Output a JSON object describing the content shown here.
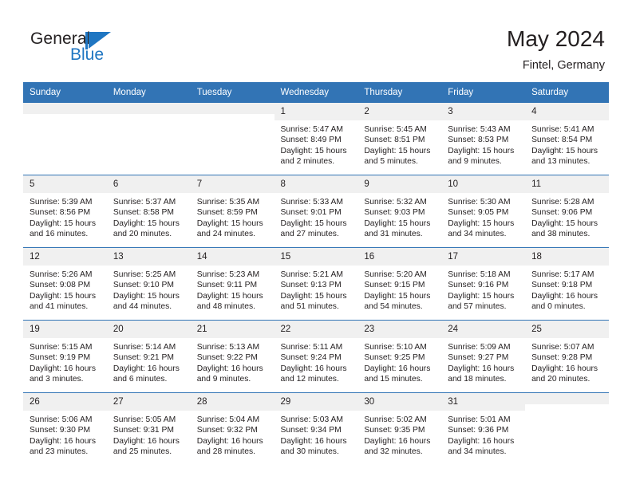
{
  "brand": {
    "name_part1": "General",
    "name_part2": "Blue",
    "flag_icon": "blue-flag-icon"
  },
  "header": {
    "title": "May 2024",
    "subtitle": "Fintel, Germany"
  },
  "colors": {
    "header_blue": "#3274b5",
    "brand_blue": "#1f76c2",
    "daynum_band": "#f0f0f0",
    "text": "#231f20"
  },
  "calendar": {
    "weekday_headers": [
      "Sunday",
      "Monday",
      "Tuesday",
      "Wednesday",
      "Thursday",
      "Friday",
      "Saturday"
    ],
    "weeks": [
      [
        {
          "day": "",
          "empty": true
        },
        {
          "day": "",
          "empty": true
        },
        {
          "day": "",
          "empty": true
        },
        {
          "day": "1",
          "sunrise": "Sunrise: 5:47 AM",
          "sunset": "Sunset: 8:49 PM",
          "daylight_line1": "Daylight: 15 hours",
          "daylight_line2": "and 2 minutes."
        },
        {
          "day": "2",
          "sunrise": "Sunrise: 5:45 AM",
          "sunset": "Sunset: 8:51 PM",
          "daylight_line1": "Daylight: 15 hours",
          "daylight_line2": "and 5 minutes."
        },
        {
          "day": "3",
          "sunrise": "Sunrise: 5:43 AM",
          "sunset": "Sunset: 8:53 PM",
          "daylight_line1": "Daylight: 15 hours",
          "daylight_line2": "and 9 minutes."
        },
        {
          "day": "4",
          "sunrise": "Sunrise: 5:41 AM",
          "sunset": "Sunset: 8:54 PM",
          "daylight_line1": "Daylight: 15 hours",
          "daylight_line2": "and 13 minutes."
        }
      ],
      [
        {
          "day": "5",
          "sunrise": "Sunrise: 5:39 AM",
          "sunset": "Sunset: 8:56 PM",
          "daylight_line1": "Daylight: 15 hours",
          "daylight_line2": "and 16 minutes."
        },
        {
          "day": "6",
          "sunrise": "Sunrise: 5:37 AM",
          "sunset": "Sunset: 8:58 PM",
          "daylight_line1": "Daylight: 15 hours",
          "daylight_line2": "and 20 minutes."
        },
        {
          "day": "7",
          "sunrise": "Sunrise: 5:35 AM",
          "sunset": "Sunset: 8:59 PM",
          "daylight_line1": "Daylight: 15 hours",
          "daylight_line2": "and 24 minutes."
        },
        {
          "day": "8",
          "sunrise": "Sunrise: 5:33 AM",
          "sunset": "Sunset: 9:01 PM",
          "daylight_line1": "Daylight: 15 hours",
          "daylight_line2": "and 27 minutes."
        },
        {
          "day": "9",
          "sunrise": "Sunrise: 5:32 AM",
          "sunset": "Sunset: 9:03 PM",
          "daylight_line1": "Daylight: 15 hours",
          "daylight_line2": "and 31 minutes."
        },
        {
          "day": "10",
          "sunrise": "Sunrise: 5:30 AM",
          "sunset": "Sunset: 9:05 PM",
          "daylight_line1": "Daylight: 15 hours",
          "daylight_line2": "and 34 minutes."
        },
        {
          "day": "11",
          "sunrise": "Sunrise: 5:28 AM",
          "sunset": "Sunset: 9:06 PM",
          "daylight_line1": "Daylight: 15 hours",
          "daylight_line2": "and 38 minutes."
        }
      ],
      [
        {
          "day": "12",
          "sunrise": "Sunrise: 5:26 AM",
          "sunset": "Sunset: 9:08 PM",
          "daylight_line1": "Daylight: 15 hours",
          "daylight_line2": "and 41 minutes."
        },
        {
          "day": "13",
          "sunrise": "Sunrise: 5:25 AM",
          "sunset": "Sunset: 9:10 PM",
          "daylight_line1": "Daylight: 15 hours",
          "daylight_line2": "and 44 minutes."
        },
        {
          "day": "14",
          "sunrise": "Sunrise: 5:23 AM",
          "sunset": "Sunset: 9:11 PM",
          "daylight_line1": "Daylight: 15 hours",
          "daylight_line2": "and 48 minutes."
        },
        {
          "day": "15",
          "sunrise": "Sunrise: 5:21 AM",
          "sunset": "Sunset: 9:13 PM",
          "daylight_line1": "Daylight: 15 hours",
          "daylight_line2": "and 51 minutes."
        },
        {
          "day": "16",
          "sunrise": "Sunrise: 5:20 AM",
          "sunset": "Sunset: 9:15 PM",
          "daylight_line1": "Daylight: 15 hours",
          "daylight_line2": "and 54 minutes."
        },
        {
          "day": "17",
          "sunrise": "Sunrise: 5:18 AM",
          "sunset": "Sunset: 9:16 PM",
          "daylight_line1": "Daylight: 15 hours",
          "daylight_line2": "and 57 minutes."
        },
        {
          "day": "18",
          "sunrise": "Sunrise: 5:17 AM",
          "sunset": "Sunset: 9:18 PM",
          "daylight_line1": "Daylight: 16 hours",
          "daylight_line2": "and 0 minutes."
        }
      ],
      [
        {
          "day": "19",
          "sunrise": "Sunrise: 5:15 AM",
          "sunset": "Sunset: 9:19 PM",
          "daylight_line1": "Daylight: 16 hours",
          "daylight_line2": "and 3 minutes."
        },
        {
          "day": "20",
          "sunrise": "Sunrise: 5:14 AM",
          "sunset": "Sunset: 9:21 PM",
          "daylight_line1": "Daylight: 16 hours",
          "daylight_line2": "and 6 minutes."
        },
        {
          "day": "21",
          "sunrise": "Sunrise: 5:13 AM",
          "sunset": "Sunset: 9:22 PM",
          "daylight_line1": "Daylight: 16 hours",
          "daylight_line2": "and 9 minutes."
        },
        {
          "day": "22",
          "sunrise": "Sunrise: 5:11 AM",
          "sunset": "Sunset: 9:24 PM",
          "daylight_line1": "Daylight: 16 hours",
          "daylight_line2": "and 12 minutes."
        },
        {
          "day": "23",
          "sunrise": "Sunrise: 5:10 AM",
          "sunset": "Sunset: 9:25 PM",
          "daylight_line1": "Daylight: 16 hours",
          "daylight_line2": "and 15 minutes."
        },
        {
          "day": "24",
          "sunrise": "Sunrise: 5:09 AM",
          "sunset": "Sunset: 9:27 PM",
          "daylight_line1": "Daylight: 16 hours",
          "daylight_line2": "and 18 minutes."
        },
        {
          "day": "25",
          "sunrise": "Sunrise: 5:07 AM",
          "sunset": "Sunset: 9:28 PM",
          "daylight_line1": "Daylight: 16 hours",
          "daylight_line2": "and 20 minutes."
        }
      ],
      [
        {
          "day": "26",
          "sunrise": "Sunrise: 5:06 AM",
          "sunset": "Sunset: 9:30 PM",
          "daylight_line1": "Daylight: 16 hours",
          "daylight_line2": "and 23 minutes."
        },
        {
          "day": "27",
          "sunrise": "Sunrise: 5:05 AM",
          "sunset": "Sunset: 9:31 PM",
          "daylight_line1": "Daylight: 16 hours",
          "daylight_line2": "and 25 minutes."
        },
        {
          "day": "28",
          "sunrise": "Sunrise: 5:04 AM",
          "sunset": "Sunset: 9:32 PM",
          "daylight_line1": "Daylight: 16 hours",
          "daylight_line2": "and 28 minutes."
        },
        {
          "day": "29",
          "sunrise": "Sunrise: 5:03 AM",
          "sunset": "Sunset: 9:34 PM",
          "daylight_line1": "Daylight: 16 hours",
          "daylight_line2": "and 30 minutes."
        },
        {
          "day": "30",
          "sunrise": "Sunrise: 5:02 AM",
          "sunset": "Sunset: 9:35 PM",
          "daylight_line1": "Daylight: 16 hours",
          "daylight_line2": "and 32 minutes."
        },
        {
          "day": "31",
          "sunrise": "Sunrise: 5:01 AM",
          "sunset": "Sunset: 9:36 PM",
          "daylight_line1": "Daylight: 16 hours",
          "daylight_line2": "and 34 minutes."
        },
        {
          "day": "",
          "empty": true
        }
      ]
    ]
  }
}
